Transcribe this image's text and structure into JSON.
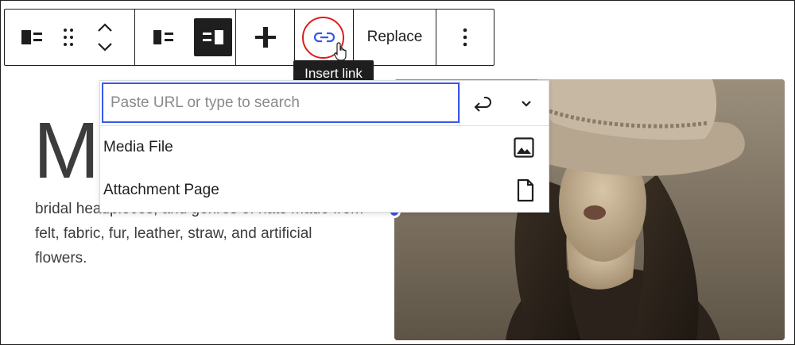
{
  "toolbar": {
    "replace_label": "Replace",
    "active_color": "#1e1e1e"
  },
  "tooltip": {
    "text": "Insert link"
  },
  "link_popover": {
    "search_placeholder": "Paste URL or type to search",
    "search_value": "",
    "options": [
      {
        "label": "Media File",
        "icon": "image-icon"
      },
      {
        "label": "Attachment Page",
        "icon": "page-icon"
      }
    ]
  },
  "content": {
    "dropcap": "M",
    "paragraph_lines": [
      "bridal headpieces, and genres of hats made from",
      "felt, fabric, fur, leather, straw, and artificial",
      "flowers."
    ]
  },
  "colors": {
    "accent": "#3858e9",
    "highlight_ring": "#e01b1b"
  }
}
